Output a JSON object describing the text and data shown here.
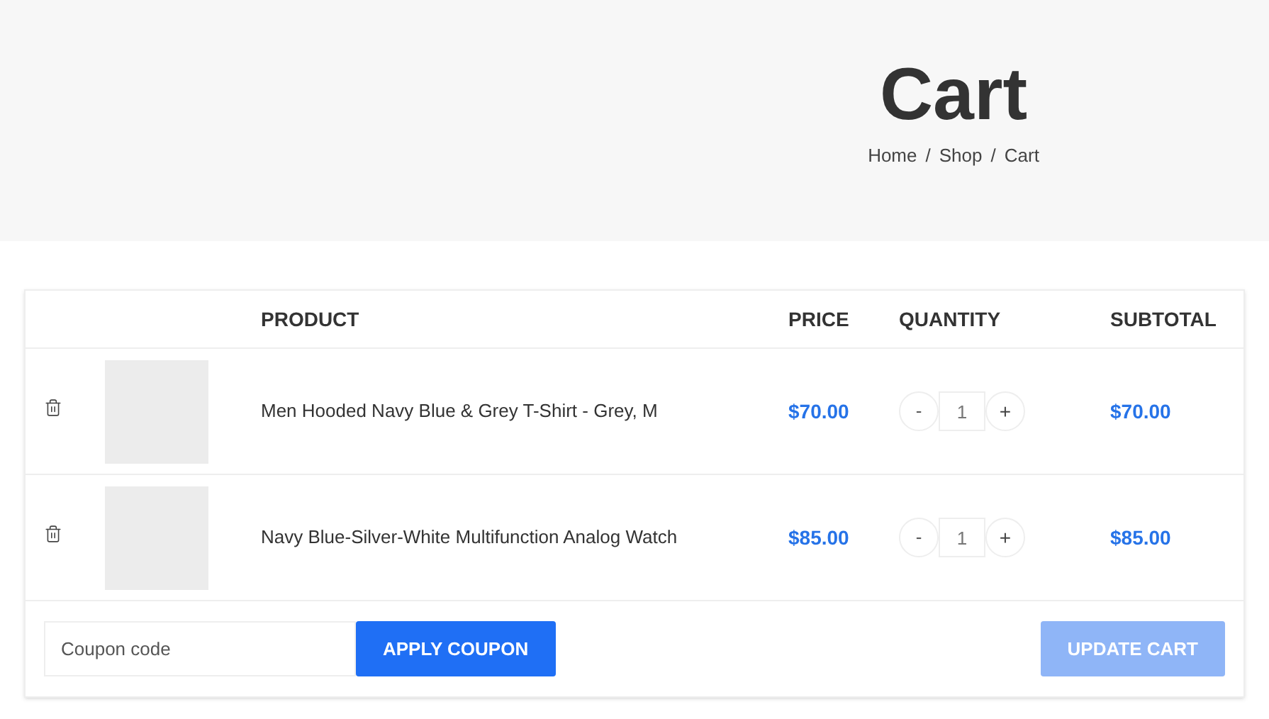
{
  "page_title": "Cart",
  "breadcrumb": [
    {
      "label": "Home"
    },
    {
      "label": "Shop"
    },
    {
      "label": "Cart"
    }
  ],
  "breadcrumb_separator": "/",
  "table": {
    "columns": [
      "PRODUCT",
      "PRICE",
      "QUANTITY",
      "SUBTOTAL"
    ],
    "rows": [
      {
        "product": "Men Hooded Navy Blue & Grey T-Shirt - Grey, M",
        "price": "$70.00",
        "quantity": "1",
        "subtotal": "$70.00"
      },
      {
        "product": "Navy Blue-Silver-White Multifunction Analog Watch",
        "price": "$85.00",
        "quantity": "1",
        "subtotal": "$85.00"
      }
    ]
  },
  "quantity_buttons": {
    "minus": "-",
    "plus": "+"
  },
  "coupon": {
    "placeholder": "Coupon code",
    "button": "APPLY COUPON"
  },
  "update_cart": {
    "label": "UPDATE CART",
    "disabled": true
  }
}
